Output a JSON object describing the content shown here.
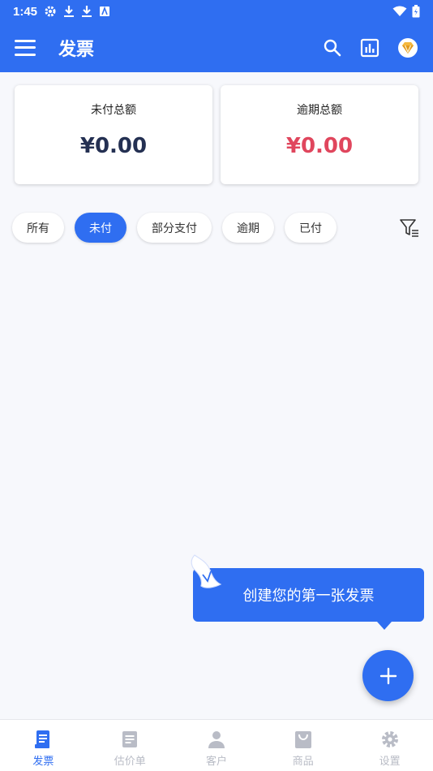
{
  "status_bar": {
    "time": "1:45"
  },
  "app_bar": {
    "title": "发票"
  },
  "summary": {
    "unpaid": {
      "label": "未付总额",
      "amount": "¥0.00"
    },
    "overdue": {
      "label": "逾期总额",
      "amount": "¥0.00"
    }
  },
  "filters": [
    {
      "label": "所有",
      "active": false
    },
    {
      "label": "未付",
      "active": true
    },
    {
      "label": "部分支付",
      "active": false
    },
    {
      "label": "逾期",
      "active": false
    },
    {
      "label": "已付",
      "active": false
    }
  ],
  "tooltip": {
    "text": "创建您的第一张发票"
  },
  "bottom_nav": [
    {
      "label": "发票",
      "icon": "invoice-icon",
      "active": true
    },
    {
      "label": "估价单",
      "icon": "estimate-icon",
      "active": false
    },
    {
      "label": "客户",
      "icon": "person-icon",
      "active": false
    },
    {
      "label": "商品",
      "icon": "bag-icon",
      "active": false
    },
    {
      "label": "设置",
      "icon": "gear-icon",
      "active": false
    }
  ],
  "colors": {
    "primary": "#2f6ef1",
    "amount_dark": "#243052",
    "amount_red": "#e0465d",
    "nav_inactive": "#b9bcc6"
  }
}
